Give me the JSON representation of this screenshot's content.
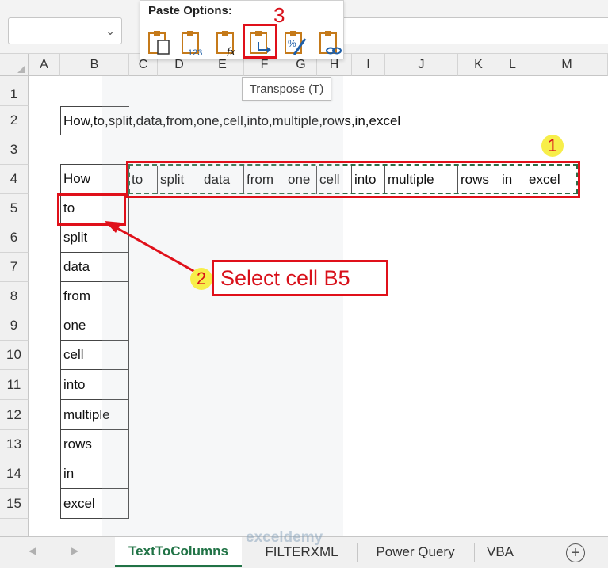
{
  "paste_options": {
    "title": "Paste Options:",
    "step_badge": "3",
    "tooltip": "Transpose (T)",
    "icons": [
      "paste-icon",
      "paste-values-icon",
      "paste-formulas-icon",
      "transpose-icon",
      "paste-formatting-icon",
      "paste-link-icon"
    ],
    "icon_123": "123",
    "icon_fx": "fx"
  },
  "columns": [
    "A",
    "B",
    "C",
    "D",
    "E",
    "F",
    "G",
    "H",
    "I",
    "J",
    "K",
    "L",
    "M"
  ],
  "rows": [
    "1",
    "2",
    "3",
    "4",
    "5",
    "6",
    "7",
    "8",
    "9",
    "10",
    "11",
    "12",
    "13",
    "14",
    "15"
  ],
  "cells": {
    "b2": "How,to,split,data,from,one,cell,into,multiple,rows,in,excel",
    "b_column": [
      "How",
      "to",
      "split",
      "data",
      "from",
      "one",
      "cell",
      "into",
      "multiple",
      "rows",
      "in",
      "excel"
    ],
    "row4": [
      "to",
      "split",
      "data",
      "from",
      "one",
      "cell",
      "into",
      "multiple",
      "rows",
      "in",
      "excel"
    ]
  },
  "annotations": {
    "badge1": "1",
    "badge2": "2",
    "callout": "Select cell B5"
  },
  "sheet_tabs": [
    "TextToColumns",
    "FILTERXML",
    "Power Query",
    "VBA"
  ],
  "watermark": "exceldemy",
  "colors": {
    "accent_green": "#217346",
    "highlight_red": "#e0101a",
    "badge_yellow": "#f7ee4a"
  }
}
